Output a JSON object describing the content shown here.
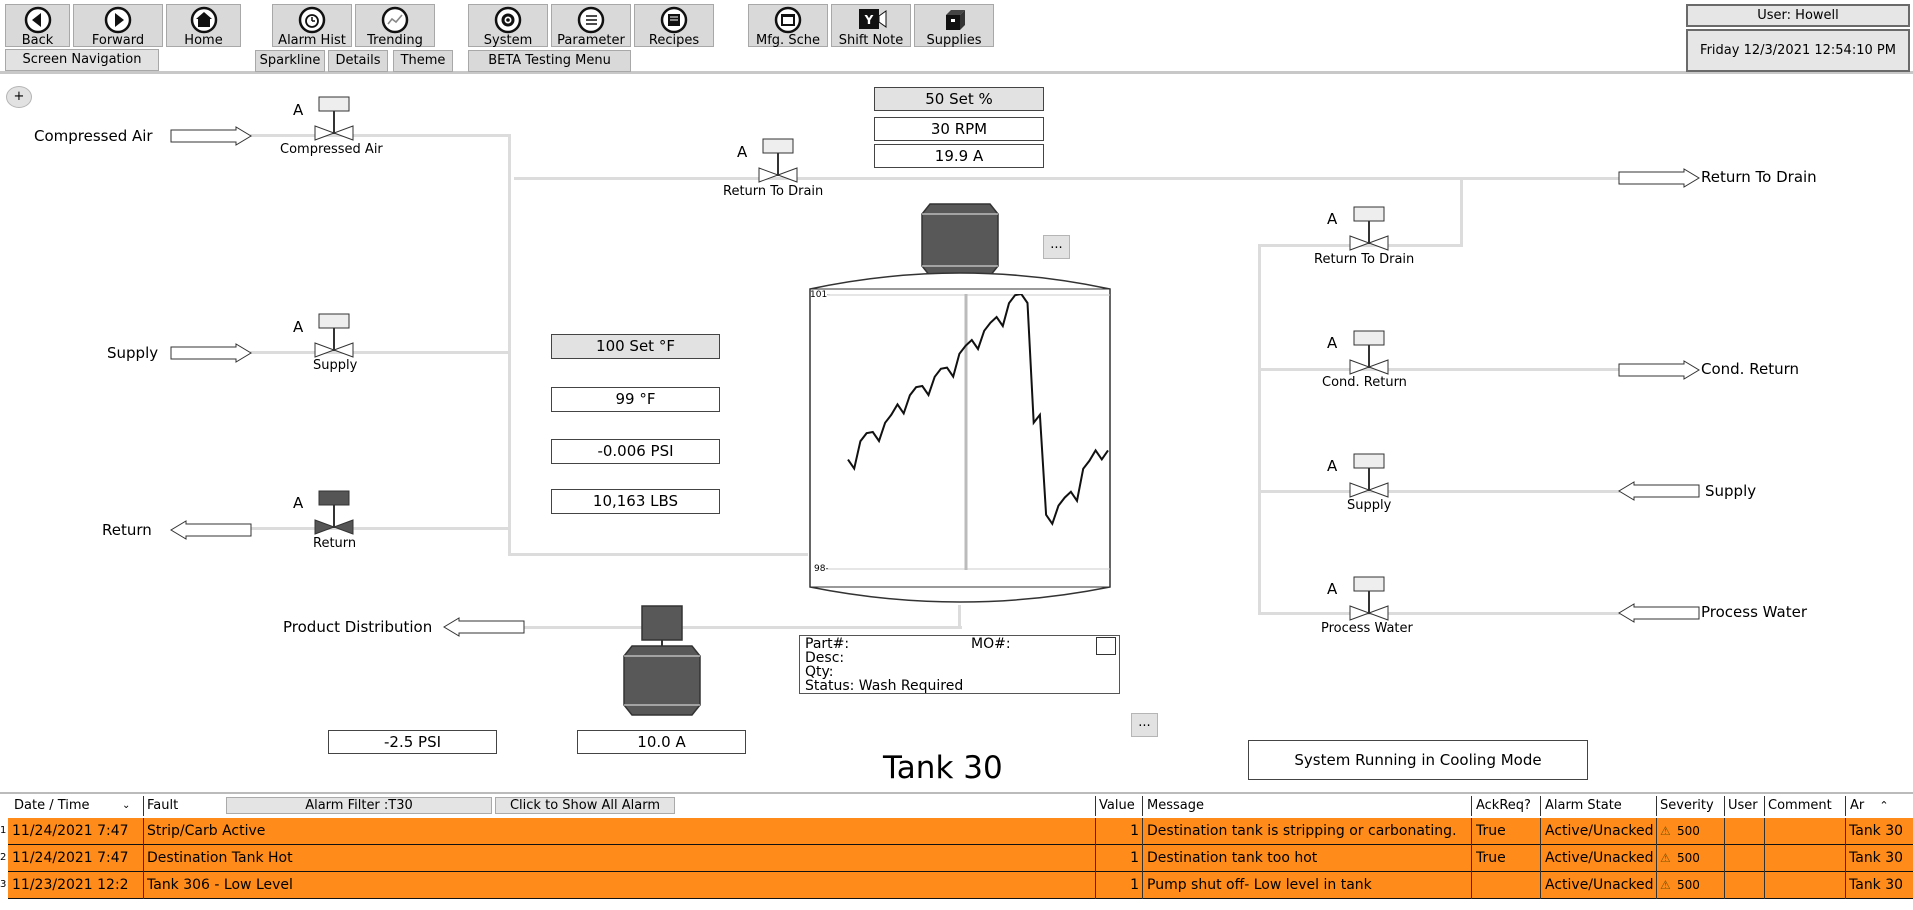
{
  "toolbar": {
    "back": "Back",
    "forward": "Forward",
    "home": "Home",
    "alarm_hist": "Alarm Hist",
    "trending": "Trending",
    "system": "System",
    "parameter": "Parameter",
    "recipes": "Recipes",
    "mfg_sche": "Mfg. Sche",
    "shift_note": "Shift Note",
    "supplies": "Supplies",
    "screen_navigation": "Screen Navigation",
    "sparkline": "Sparkline",
    "details": "Details",
    "theme": "Theme",
    "beta_menu": "BETA Testing Menu",
    "user": "User: Howell",
    "datetime": "Friday 12/3/2021 12:54:10 PM"
  },
  "colors": {
    "alarm_row": "#ff8c1a",
    "pipe": "#dcdcdc",
    "equipment": "#585858"
  },
  "left": {
    "compressed_air": "Compressed Air",
    "supply": "Supply",
    "return": "Return",
    "product_distribution": "Product Distribution",
    "valve_mode": "A",
    "compressed_air_valve": "Compressed Air",
    "supply_valve": "Supply",
    "return_valve": "Return"
  },
  "top": {
    "return_to_drain_valve": "Return To Drain",
    "valve_mode": "A",
    "set_pct": "50  Set %",
    "rpm": "30   RPM",
    "amps": "19.9   A",
    "more": "..."
  },
  "middle": {
    "set_temp": "100  Set °F",
    "temp": "99   °F",
    "psi": "-0.006   PSI",
    "lbs": "10,163   LBS"
  },
  "tank": {
    "name": "Tank 30",
    "y_max": "101-",
    "y_min": "98-",
    "part": "Part#:",
    "mo": "MO#:",
    "desc": "Desc:",
    "qty": "Qty:",
    "status": "Status: Wash Required",
    "sparkline": [
      99.2,
      99.4,
      99.5,
      99.6,
      99.8,
      99.9,
      100.0,
      100.1,
      100.2,
      100.35,
      100.5,
      100.6,
      100.75,
      100.9,
      101.0,
      99.6,
      98.6,
      98.7,
      98.85,
      99.1,
      99.3,
      99.3
    ]
  },
  "bottom": {
    "psi": "-2.5   PSI",
    "amps": "10.0   A",
    "more": "...",
    "status_message": "System Running in Cooling Mode"
  },
  "right": {
    "return_to_drain": "Return To Drain",
    "cond_return": "Cond. Return",
    "supply": "Supply",
    "process_water": "Process Water",
    "valve_mode": "A",
    "return_to_drain_valve": "Return To Drain",
    "cond_return_valve": "Cond. Return",
    "supply_valve": "Supply",
    "process_water_valve": "Process Water"
  },
  "alarms": {
    "headers": {
      "datetime": "Date / Time",
      "fault": "Fault",
      "filter": "Alarm Filter :T30",
      "show_all": "Click to Show All Alarm",
      "value": "Value",
      "message": "Message",
      "ackreq": "AckReq?",
      "state": "Alarm State",
      "severity": "Severity",
      "user": "User",
      "comment": "Comment",
      "area": "Ar"
    },
    "rows": [
      {
        "num": "1",
        "datetime": "11/24/2021 7:47",
        "fault": "Strip/Carb Active",
        "value": "1",
        "message": "Destination tank is stripping or carbonating.",
        "ackreq": "True",
        "state": "Active/Unacked",
        "severity": "500",
        "area": "Tank 30"
      },
      {
        "num": "2",
        "datetime": "11/24/2021 7:47",
        "fault": "Destination Tank Hot",
        "value": "1",
        "message": "Destination tank too hot",
        "ackreq": "True",
        "state": "Active/Unacked",
        "severity": "500",
        "area": "Tank 30"
      },
      {
        "num": "3",
        "datetime": "11/23/2021 12:2",
        "fault": "Tank 306 - Low Level",
        "value": "1",
        "message": "Pump shut off- Low level in tank",
        "ackreq": "",
        "state": "Active/Unacked",
        "severity": "500",
        "area": "Tank 30"
      }
    ]
  }
}
